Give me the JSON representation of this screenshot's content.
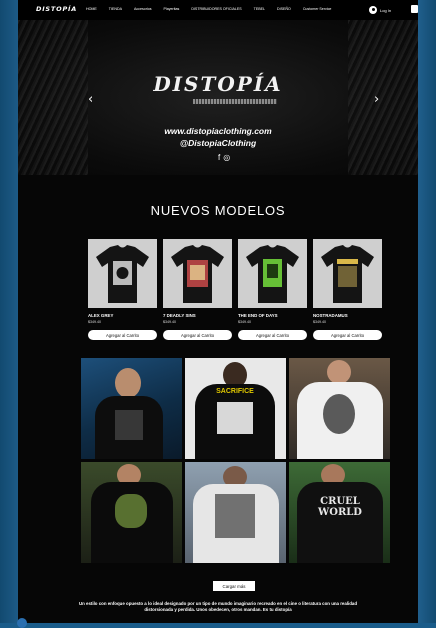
{
  "nav": {
    "logo": "DISTOPÍA",
    "items": [
      "HOME",
      "TIENDA",
      "Accesorios",
      "Playeritas",
      "DISTRIBUIDORES OFICIALES",
      "TEBEL",
      "DISEÑO",
      "Customer Service"
    ],
    "login_label": "Log In"
  },
  "hero": {
    "brand": "DISTOPÍA",
    "website": "www.distopiaclothing.com",
    "handle": "@DistopiaClothing",
    "prev_arrow": "‹",
    "next_arrow": "›"
  },
  "section": {
    "title": "NUEVOS MODELOS"
  },
  "products": [
    {
      "name": "ALEX GREY",
      "price": "$349.40",
      "button": "Agregar al Carrito",
      "print_color": "#d8d8d8"
    },
    {
      "name": "7 DEADLY SINS",
      "price": "$349.40",
      "button": "Agregar al Carrito",
      "print_color": "#c94a4a"
    },
    {
      "name": "THE END OF DAYS",
      "price": "$349.40",
      "button": "Agregar al Carrito",
      "print_color": "#6fd23a"
    },
    {
      "name": "NOSTRADAMUS",
      "price": "$349.40",
      "button": "Agregar al Carrito",
      "print_color": "#d9b84a"
    }
  ],
  "gallery": {
    "photo3_text": "SACRIFICE",
    "photo6_text": "CRUEL WORLD"
  },
  "load_more": "Cargar más",
  "description": "Un estilo con enfoque opuesto a lo ideal designado por un tipo de mundo imaginario recreado en el cine o literatura con una realidad distorsionada y perdida. Unos obedecen, otros mandan. Es tu distopía",
  "colors": {
    "page_bg": "#060606",
    "accent_side": "#1a5c8a",
    "button_bg": "#ffffff"
  }
}
